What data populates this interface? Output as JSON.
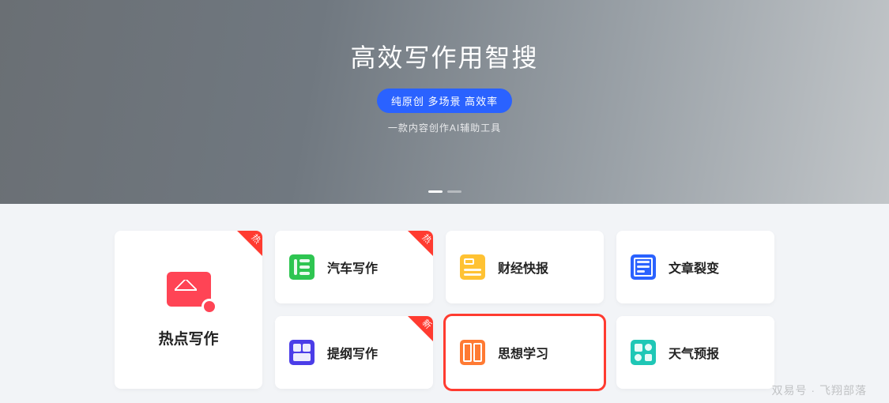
{
  "hero": {
    "title": "高效写作用智搜",
    "pill": "纯原创 多场景 高效率",
    "subtitle": "一款内容创作AI辅助工具"
  },
  "corner_labels": {
    "hot": "热",
    "new": "新"
  },
  "featured": {
    "label": "热点写作",
    "badge": "hot"
  },
  "cards": [
    {
      "label": "汽车写作",
      "icon": "green",
      "badge": "hot"
    },
    {
      "label": "财经快报",
      "icon": "yellow",
      "badge": null
    },
    {
      "label": "文章裂变",
      "icon": "blue",
      "badge": null
    },
    {
      "label": "提纲写作",
      "icon": "purple",
      "badge": "new"
    },
    {
      "label": "思想学习",
      "icon": "orange",
      "badge": null,
      "selected": true
    },
    {
      "label": "天气预报",
      "icon": "teal",
      "badge": null
    }
  ],
  "watermark": "双易号 · 飞翔部落"
}
